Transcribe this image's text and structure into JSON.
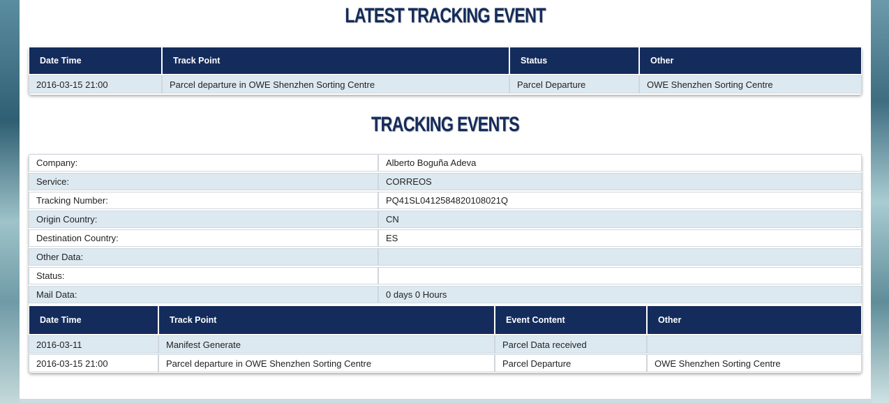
{
  "latest": {
    "title": "Latest Tracking Event",
    "headers": [
      "Date Time",
      "Track Point",
      "Status",
      "Other"
    ],
    "row": [
      "2016-03-15 21:00",
      "Parcel departure in OWE Shenzhen Sorting Centre",
      "Parcel Departure",
      "OWE Shenzhen Sorting Centre"
    ]
  },
  "events": {
    "title": "Tracking Events",
    "info": [
      {
        "label": "Company:",
        "value": "Alberto Boguña Adeva"
      },
      {
        "label": "Service:",
        "value": "CORREOS"
      },
      {
        "label": "Tracking Number:",
        "value": "PQ41SL0412584820108021Q"
      },
      {
        "label": "Origin Country:",
        "value": "CN"
      },
      {
        "label": "Destination Country:",
        "value": "ES"
      },
      {
        "label": "Other Data:",
        "value": ""
      },
      {
        "label": "Status:",
        "value": ""
      },
      {
        "label": "Mail Data:",
        "value": "0 days 0 Hours"
      }
    ],
    "headers": [
      "Date Time",
      "Track Point",
      "Event Content",
      "Other"
    ],
    "rows": [
      [
        "2016-03-11",
        "Manifest Generate",
        "Parcel Data received",
        ""
      ],
      [
        "2016-03-15 21:00",
        "Parcel departure in OWE Shenzhen Sorting Centre",
        "Parcel Departure",
        "OWE Shenzhen Sorting Centre"
      ]
    ]
  }
}
